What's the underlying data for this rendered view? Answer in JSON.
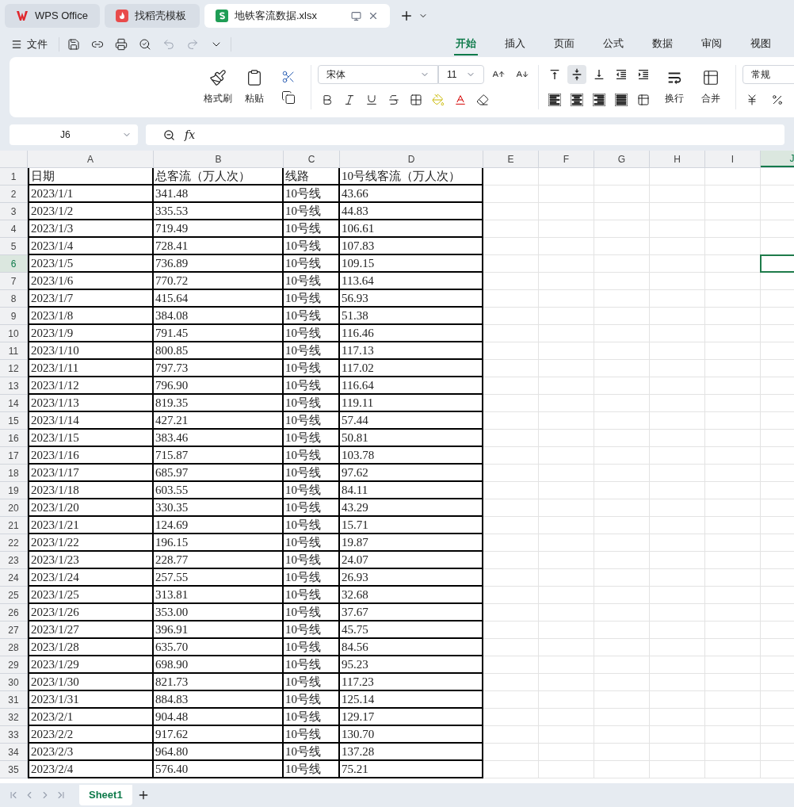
{
  "window_tabs": [
    {
      "label": "WPS Office",
      "kind": "wps",
      "selected": false
    },
    {
      "label": "找稻壳模板",
      "kind": "docer",
      "selected": false
    },
    {
      "label": "地铁客流数据.xlsx",
      "kind": "sheet",
      "selected": true
    }
  ],
  "file_menu": "文件",
  "ribbon_tabs": [
    {
      "label": "开始",
      "selected": true
    },
    {
      "label": "插入",
      "selected": false
    },
    {
      "label": "页面",
      "selected": false
    },
    {
      "label": "公式",
      "selected": false
    },
    {
      "label": "数据",
      "selected": false
    },
    {
      "label": "审阅",
      "selected": false
    },
    {
      "label": "视图",
      "selected": false
    }
  ],
  "clipboard": {
    "format_painter": "格式刷",
    "paste": "粘贴"
  },
  "font": {
    "name": "宋体",
    "size": "11"
  },
  "align_buttons": [
    {
      "kind": "top",
      "selected": false
    },
    {
      "kind": "middle",
      "selected": true
    },
    {
      "kind": "bottom",
      "selected": false
    },
    {
      "kind": "outdent",
      "selected": false
    },
    {
      "kind": "indent",
      "selected": false
    }
  ],
  "wrap": "换行",
  "merge": "合并",
  "number_format": "常规",
  "name_box": "J6",
  "function_label": "fx",
  "columns": [
    {
      "label": "A",
      "selected": false
    },
    {
      "label": "B",
      "selected": false
    },
    {
      "label": "C",
      "selected": false
    },
    {
      "label": "D",
      "selected": false
    },
    {
      "label": "E",
      "selected": false
    },
    {
      "label": "F",
      "selected": false
    },
    {
      "label": "G",
      "selected": false
    },
    {
      "label": "H",
      "selected": false
    },
    {
      "label": "I",
      "selected": false
    },
    {
      "label": "J",
      "selected": true
    }
  ],
  "rows": [
    {
      "number": "1",
      "selected": false,
      "cells": [
        "日期",
        "总客流（万人次）",
        "线路",
        "10号线客流（万人次）"
      ]
    },
    {
      "number": "2",
      "selected": false,
      "cells": [
        "2023/1/1",
        "341.48",
        "10号线",
        "43.66"
      ]
    },
    {
      "number": "3",
      "selected": false,
      "cells": [
        "2023/1/2",
        "335.53",
        "10号线",
        "44.83"
      ]
    },
    {
      "number": "4",
      "selected": false,
      "cells": [
        "2023/1/3",
        "719.49",
        "10号线",
        "106.61"
      ]
    },
    {
      "number": "5",
      "selected": false,
      "cells": [
        "2023/1/4",
        "728.41",
        "10号线",
        "107.83"
      ]
    },
    {
      "number": "6",
      "selected": true,
      "cells": [
        "2023/1/5",
        "736.89",
        "10号线",
        "109.15"
      ]
    },
    {
      "number": "7",
      "selected": false,
      "cells": [
        "2023/1/6",
        "770.72",
        "10号线",
        "113.64"
      ]
    },
    {
      "number": "8",
      "selected": false,
      "cells": [
        "2023/1/7",
        "415.64",
        "10号线",
        "56.93"
      ]
    },
    {
      "number": "9",
      "selected": false,
      "cells": [
        "2023/1/8",
        "384.08",
        "10号线",
        "51.38"
      ]
    },
    {
      "number": "10",
      "selected": false,
      "cells": [
        "2023/1/9",
        "791.45",
        "10号线",
        "116.46"
      ]
    },
    {
      "number": "11",
      "selected": false,
      "cells": [
        "2023/1/10",
        "800.85",
        "10号线",
        "117.13"
      ]
    },
    {
      "number": "12",
      "selected": false,
      "cells": [
        "2023/1/11",
        "797.73",
        "10号线",
        "117.02"
      ]
    },
    {
      "number": "13",
      "selected": false,
      "cells": [
        "2023/1/12",
        "796.90",
        "10号线",
        "116.64"
      ]
    },
    {
      "number": "14",
      "selected": false,
      "cells": [
        "2023/1/13",
        "819.35",
        "10号线",
        "119.11"
      ]
    },
    {
      "number": "15",
      "selected": false,
      "cells": [
        "2023/1/14",
        "427.21",
        "10号线",
        "57.44"
      ]
    },
    {
      "number": "16",
      "selected": false,
      "cells": [
        "2023/1/15",
        "383.46",
        "10号线",
        "50.81"
      ]
    },
    {
      "number": "17",
      "selected": false,
      "cells": [
        "2023/1/16",
        "715.87",
        "10号线",
        "103.78"
      ]
    },
    {
      "number": "18",
      "selected": false,
      "cells": [
        "2023/1/17",
        "685.97",
        "10号线",
        "97.62"
      ]
    },
    {
      "number": "19",
      "selected": false,
      "cells": [
        "2023/1/18",
        "603.55",
        "10号线",
        "84.11"
      ]
    },
    {
      "number": "20",
      "selected": false,
      "cells": [
        "2023/1/20",
        "330.35",
        "10号线",
        "43.29"
      ]
    },
    {
      "number": "21",
      "selected": false,
      "cells": [
        "2023/1/21",
        "124.69",
        "10号线",
        "15.71"
      ]
    },
    {
      "number": "22",
      "selected": false,
      "cells": [
        "2023/1/22",
        "196.15",
        "10号线",
        "19.87"
      ]
    },
    {
      "number": "23",
      "selected": false,
      "cells": [
        "2023/1/23",
        "228.77",
        "10号线",
        "24.07"
      ]
    },
    {
      "number": "24",
      "selected": false,
      "cells": [
        "2023/1/24",
        "257.55",
        "10号线",
        "26.93"
      ]
    },
    {
      "number": "25",
      "selected": false,
      "cells": [
        "2023/1/25",
        "313.81",
        "10号线",
        "32.68"
      ]
    },
    {
      "number": "26",
      "selected": false,
      "cells": [
        "2023/1/26",
        "353.00",
        "10号线",
        "37.67"
      ]
    },
    {
      "number": "27",
      "selected": false,
      "cells": [
        "2023/1/27",
        "396.91",
        "10号线",
        "45.75"
      ]
    },
    {
      "number": "28",
      "selected": false,
      "cells": [
        "2023/1/28",
        "635.70",
        "10号线",
        "84.56"
      ]
    },
    {
      "number": "29",
      "selected": false,
      "cells": [
        "2023/1/29",
        "698.90",
        "10号线",
        "95.23"
      ]
    },
    {
      "number": "30",
      "selected": false,
      "cells": [
        "2023/1/30",
        "821.73",
        "10号线",
        "117.23"
      ]
    },
    {
      "number": "31",
      "selected": false,
      "cells": [
        "2023/1/31",
        "884.83",
        "10号线",
        "125.14"
      ]
    },
    {
      "number": "32",
      "selected": false,
      "cells": [
        "2023/2/1",
        "904.48",
        "10号线",
        "129.17"
      ]
    },
    {
      "number": "33",
      "selected": false,
      "cells": [
        "2023/2/2",
        "917.62",
        "10号线",
        "130.70"
      ]
    },
    {
      "number": "34",
      "selected": false,
      "cells": [
        "2023/2/3",
        "964.80",
        "10号线",
        "137.28"
      ]
    },
    {
      "number": "35",
      "selected": false,
      "cells": [
        "2023/2/4",
        "576.40",
        "10号线",
        "75.21"
      ]
    }
  ],
  "sheet_tabs": [
    {
      "label": "Sheet1",
      "selected": true
    }
  ]
}
